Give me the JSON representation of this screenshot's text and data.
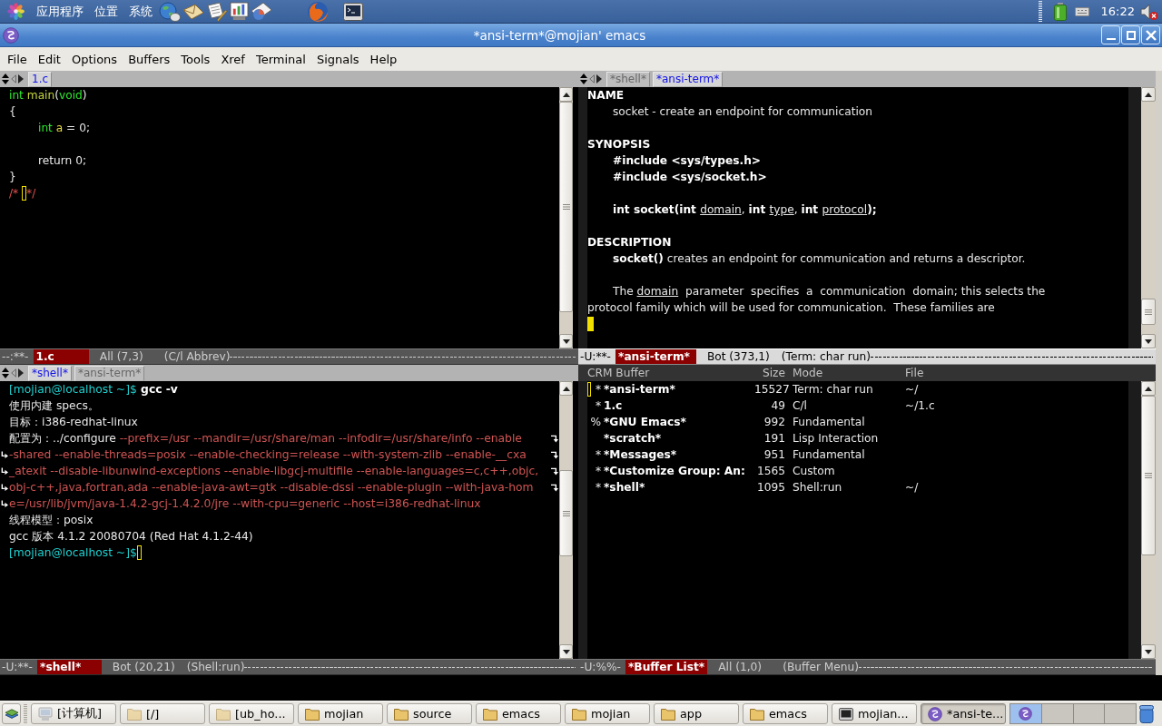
{
  "top_panel": {
    "menus": [
      "应用程序",
      "位置",
      "系统"
    ],
    "clock": "16:22"
  },
  "window": {
    "title": "*ansi-term*@mojian' emacs"
  },
  "menu_bar": [
    "File",
    "Edit",
    "Options",
    "Buffers",
    "Tools",
    "Xref",
    "Terminal",
    "Signals",
    "Help"
  ],
  "windows": [
    {
      "kind": "code",
      "active": false,
      "tabs": [
        {
          "label": "1.c",
          "selected": true
        }
      ],
      "lines": [
        {
          "kind": "text",
          "indented": false,
          "segments": [
            {
              "text": "int",
              "kind": "type"
            },
            {
              "text": " main",
              "kind": "function"
            },
            {
              "text": "(",
              "kind": "plain"
            },
            {
              "text": "void",
              "kind": "type"
            },
            {
              "text": ")",
              "kind": "plain"
            }
          ]
        },
        {
          "kind": "text",
          "indented": false,
          "segments": [
            {
              "text": "{",
              "kind": "plain"
            }
          ]
        },
        {
          "kind": "text",
          "indented": true,
          "segments": [
            {
              "text": "int",
              "kind": "type"
            },
            {
              "text": " a",
              "kind": "variable"
            },
            {
              "text": " = 0;",
              "kind": "plain"
            }
          ]
        },
        {
          "kind": "blank"
        },
        {
          "kind": "text",
          "indented": true,
          "segments": [
            {
              "text": "return 0;",
              "kind": "plain"
            }
          ]
        },
        {
          "kind": "text",
          "indented": false,
          "segments": [
            {
              "text": "}",
              "kind": "plain"
            }
          ]
        },
        {
          "kind": "text",
          "indented": false,
          "segments": [
            {
              "text": "/* ",
              "kind": "comment"
            },
            {
              "kind": "cursor"
            },
            {
              "text": "*/",
              "kind": "comment"
            }
          ]
        }
      ],
      "mode_line": {
        "flags": "--:**-",
        "buffer": "1.c",
        "position": "All (7,3)",
        "modes": "(C/l Abbrev)"
      }
    },
    {
      "kind": "terminal",
      "active": true,
      "tabs": [
        {
          "label": "*shell*",
          "selected": false
        },
        {
          "label": "*ansi-term*",
          "selected": true
        }
      ],
      "lines": [
        {
          "kind": "text",
          "indented": false,
          "segments": [
            {
              "text": "NAME",
              "kind": "bold"
            }
          ]
        },
        {
          "kind": "text",
          "indented": true,
          "segments": [
            {
              "text": "socket - create an endpoint for communication",
              "kind": "plain"
            }
          ]
        },
        {
          "kind": "blank"
        },
        {
          "kind": "text",
          "indented": false,
          "segments": [
            {
              "text": "SYNOPSIS",
              "kind": "bold"
            }
          ]
        },
        {
          "kind": "text",
          "indented": true,
          "segments": [
            {
              "text": "#include <sys/types.h>",
              "kind": "bold"
            }
          ]
        },
        {
          "kind": "text",
          "indented": true,
          "segments": [
            {
              "text": "#include <sys/socket.h>",
              "kind": "bold"
            }
          ]
        },
        {
          "kind": "blank"
        },
        {
          "kind": "text",
          "indented": true,
          "segments": [
            {
              "text": "int socket(int ",
              "kind": "bold"
            },
            {
              "text": "domain",
              "kind": "underline"
            },
            {
              "text": ", ",
              "kind": "plain"
            },
            {
              "text": "int ",
              "kind": "bold"
            },
            {
              "text": "type",
              "kind": "underline"
            },
            {
              "text": ", ",
              "kind": "plain"
            },
            {
              "text": "int ",
              "kind": "bold"
            },
            {
              "text": "protocol",
              "kind": "underline"
            },
            {
              "text": ");",
              "kind": "bold"
            }
          ]
        },
        {
          "kind": "blank"
        },
        {
          "kind": "text",
          "indented": false,
          "segments": [
            {
              "text": "DESCRIPTION",
              "kind": "bold"
            }
          ]
        },
        {
          "kind": "text",
          "indented": true,
          "segments": [
            {
              "text": "socket()",
              "kind": "bold"
            },
            {
              "text": " creates an endpoint for communication and returns a descriptor.",
              "kind": "plain"
            }
          ]
        },
        {
          "kind": "blank"
        },
        {
          "kind": "text",
          "indented": true,
          "segments": [
            {
              "text": "The ",
              "kind": "plain"
            },
            {
              "text": "domain",
              "kind": "underline"
            },
            {
              "text": "  parameter  specifies  a  communication  domain; this selects the",
              "kind": "plain"
            }
          ]
        },
        {
          "kind": "text",
          "indented": false,
          "segments": [
            {
              "text": "protocol family which will be used for communication.  These families are",
              "kind": "plain"
            }
          ]
        },
        {
          "kind": "text",
          "indented": false,
          "segments": [
            {
              "kind": "cursor"
            }
          ]
        }
      ],
      "mode_line": {
        "flags": "-U:**-",
        "buffer": "*ansi-term*",
        "position": "Bot (373,1)",
        "modes": "(Term: char run)"
      }
    },
    {
      "kind": "shell",
      "active": false,
      "tabs": [
        {
          "label": "*shell*",
          "selected": true
        },
        {
          "label": "*ansi-term*",
          "selected": false
        }
      ],
      "lines": [
        {
          "kind": "text",
          "indented": false,
          "continued": false,
          "continues": false,
          "segments": [
            {
              "text": "[mojian@localhost ~]$",
              "kind": "prompt"
            },
            {
              "text": " gcc -v",
              "kind": "command"
            }
          ]
        },
        {
          "kind": "text",
          "indented": false,
          "continued": false,
          "continues": false,
          "segments": [
            {
              "text": "使用内建 specs。",
              "kind": "plain"
            }
          ]
        },
        {
          "kind": "text",
          "indented": false,
          "continued": false,
          "continues": false,
          "segments": [
            {
              "text": "目标：i386-redhat-linux",
              "kind": "plain"
            }
          ]
        },
        {
          "kind": "text",
          "indented": false,
          "continued": false,
          "continues": true,
          "segments": [
            {
              "text": "配置为：../configure",
              "kind": "plain"
            },
            {
              "text": " --prefix=/usr --mandir=/usr/share/man --infodir=/usr/share/info --enable",
              "kind": "option"
            }
          ]
        },
        {
          "kind": "text",
          "indented": false,
          "continued": true,
          "continues": true,
          "segments": [
            {
              "text": "-shared --enable-threads=posix --enable-checking=release --with-system-zlib --enable-__cxa",
              "kind": "option"
            }
          ]
        },
        {
          "kind": "text",
          "indented": false,
          "continued": true,
          "continues": true,
          "segments": [
            {
              "text": "_atexit --disable-libunwind-exceptions --enable-libgcj-multifile --enable-languages=c,c++,objc,",
              "kind": "option"
            }
          ]
        },
        {
          "kind": "text",
          "indented": false,
          "continued": true,
          "continues": true,
          "segments": [
            {
              "text": "obj-c++,java,fortran,ada --enable-java-awt=gtk --disable-dssi --enable-plugin --with-java-hom",
              "kind": "option"
            }
          ]
        },
        {
          "kind": "text",
          "indented": false,
          "continued": true,
          "continues": false,
          "segments": [
            {
              "text": "e=/usr/lib/jvm/java-1.4.2-gcj-1.4.2.0/jre --with-cpu=generic --host=i386-redhat-linux",
              "kind": "option"
            }
          ]
        },
        {
          "kind": "text",
          "indented": false,
          "continued": false,
          "continues": false,
          "segments": [
            {
              "text": "线程模型：posix",
              "kind": "plain"
            }
          ]
        },
        {
          "kind": "text",
          "indented": false,
          "continued": false,
          "continues": false,
          "segments": [
            {
              "text": "gcc 版本 4.1.2 20080704 (Red Hat 4.1.2-44)",
              "kind": "plain"
            }
          ]
        },
        {
          "kind": "text",
          "indented": false,
          "continued": false,
          "continues": false,
          "segments": [
            {
              "text": "[mojian@localhost ~]$",
              "kind": "prompt"
            },
            {
              "kind": "cursor"
            }
          ]
        }
      ],
      "mode_line": {
        "flags": "-U:**-",
        "buffer": "*shell*",
        "position": "Bot (20,21)",
        "modes": "(Shell:run)"
      }
    },
    {
      "kind": "buffer_list",
      "active": false,
      "header": [
        "CRM Buffer",
        "Size",
        "Mode",
        "File"
      ],
      "rows": [
        {
          "cursor": true,
          "flags": "*",
          "name": "*ansi-term*",
          "size": "15527",
          "mode": "Term: char run",
          "file": "~/"
        },
        {
          "cursor": false,
          "flags": "*",
          "name": "1.c",
          "size": "49",
          "mode": "C/l",
          "file": "~/1.c"
        },
        {
          "cursor": false,
          "flags": "%",
          "name": "*GNU Emacs*",
          "size": "992",
          "mode": "Fundamental"
        },
        {
          "cursor": false,
          "name": "*scratch*",
          "size": "191",
          "mode": "Lisp Interaction"
        },
        {
          "cursor": false,
          "flags": "*",
          "name": "*Messages*",
          "size": "951",
          "mode": "Fundamental"
        },
        {
          "cursor": false,
          "flags": "*",
          "name": "*Customize Group: An:",
          "size": "1565",
          "mode": "Custom"
        },
        {
          "cursor": false,
          "flags": "*",
          "name": "*shell*",
          "size": "1095",
          "mode": "Shell:run",
          "file": "~/"
        }
      ],
      "mode_line": {
        "flags": "-U:%%-",
        "buffer": "*Buffer List*",
        "position": "All (1,0)",
        "modes": "(Buffer Menu)"
      }
    }
  ],
  "taskbar": {
    "buttons": [
      {
        "label": "[计算机]",
        "kind": "computer",
        "minimized": true,
        "selected": false
      },
      {
        "label": "[/]",
        "kind": "folder",
        "minimized": true,
        "selected": false
      },
      {
        "label": "[ub_ho...",
        "kind": "folder",
        "minimized": true,
        "selected": false
      },
      {
        "label": "mojian",
        "kind": "folder",
        "minimized": false,
        "selected": false
      },
      {
        "label": "source",
        "kind": "folder",
        "minimized": false,
        "selected": false
      },
      {
        "label": "emacs",
        "kind": "folder",
        "minimized": false,
        "selected": false
      },
      {
        "label": "mojian",
        "kind": "folder",
        "minimized": false,
        "selected": false
      },
      {
        "label": "app",
        "kind": "folder",
        "minimized": false,
        "selected": false
      },
      {
        "label": "emacs",
        "kind": "folder",
        "minimized": false,
        "selected": false
      },
      {
        "label": "mojian...",
        "kind": "terminal",
        "minimized": false,
        "selected": false
      },
      {
        "label": "*ansi-te...",
        "kind": "editor",
        "minimized": false,
        "selected": true
      }
    ],
    "workspaces": [
      {
        "selected": true
      },
      {
        "selected": false
      },
      {
        "selected": false
      },
      {
        "selected": false
      }
    ]
  }
}
